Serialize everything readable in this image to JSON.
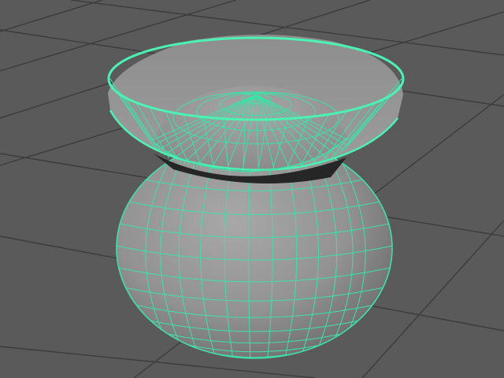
{
  "viewport": {
    "background": "#5a5a5a",
    "grid_color": "#3c3c3c",
    "mesh_fill": "#9a9a9a",
    "mesh_shade": "#6e6e6e",
    "inner_dark": "#262626",
    "wire_color": "#3fe0a8",
    "selection_outline": "#4cf2b4"
  },
  "scene": {
    "object": "vase-mesh",
    "selected": true,
    "display_mode": "shaded-wireframe"
  }
}
